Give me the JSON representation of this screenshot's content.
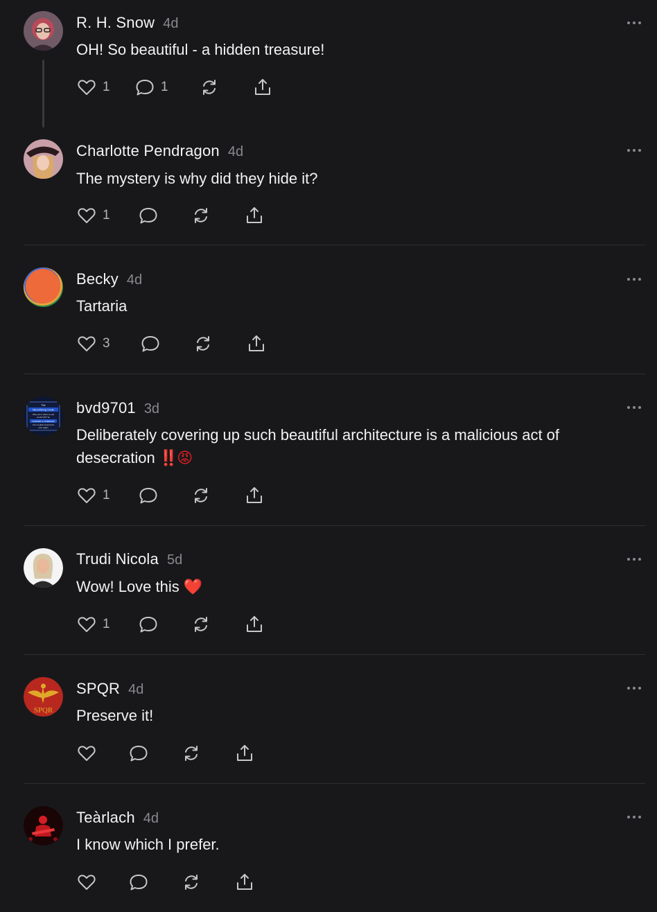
{
  "posts": [
    {
      "name": "R. H. Snow",
      "time": "4d",
      "text": "OH! So beautiful - a hidden treasure!",
      "likes": "1",
      "replies": "1"
    },
    {
      "name": "Charlotte Pendragon",
      "time": "4d",
      "text": "The mystery is why did they hide it?",
      "likes": "1",
      "replies": ""
    },
    {
      "name": "Becky",
      "time": "4d",
      "text": "Tartaria",
      "likes": "3",
      "replies": ""
    },
    {
      "name": "bvd9701",
      "time": "3d",
      "text_line1": "Deliberately covering up such beautiful architecture is a malicious act of",
      "text_line2": "desecration",
      "text_emoji": "‼️😡",
      "likes": "1",
      "replies": "",
      "avatar_text": {
        "title": "The",
        "header": "Nuremberg Code",
        "line1": "Was put in place so ppl",
        "line2": "would NOT be",
        "line3": "FORCED or COERCED",
        "line4": "into medical treatments",
        "line5": "ever again"
      }
    },
    {
      "name": "Trudi Nicola",
      "time": "5d",
      "text": "Wow! Love this",
      "text_emoji": "❤️",
      "likes": "1",
      "replies": ""
    },
    {
      "name": "SPQR",
      "time": "4d",
      "text": "Preserve it!",
      "likes": "",
      "replies": "",
      "avatar_text": "SPQR"
    },
    {
      "name": "Teàrlach",
      "time": "4d",
      "text": "I know which I prefer.",
      "likes": "",
      "replies": ""
    }
  ],
  "icons": {
    "like": "heart-icon",
    "reply": "comment-icon",
    "repost": "repost-icon",
    "share": "share-icon",
    "more": "more-icon"
  },
  "colors": {
    "background": "#18181b",
    "text": "#f2f2f2",
    "muted": "#8a8a8e",
    "divider": "#2e2e31"
  }
}
